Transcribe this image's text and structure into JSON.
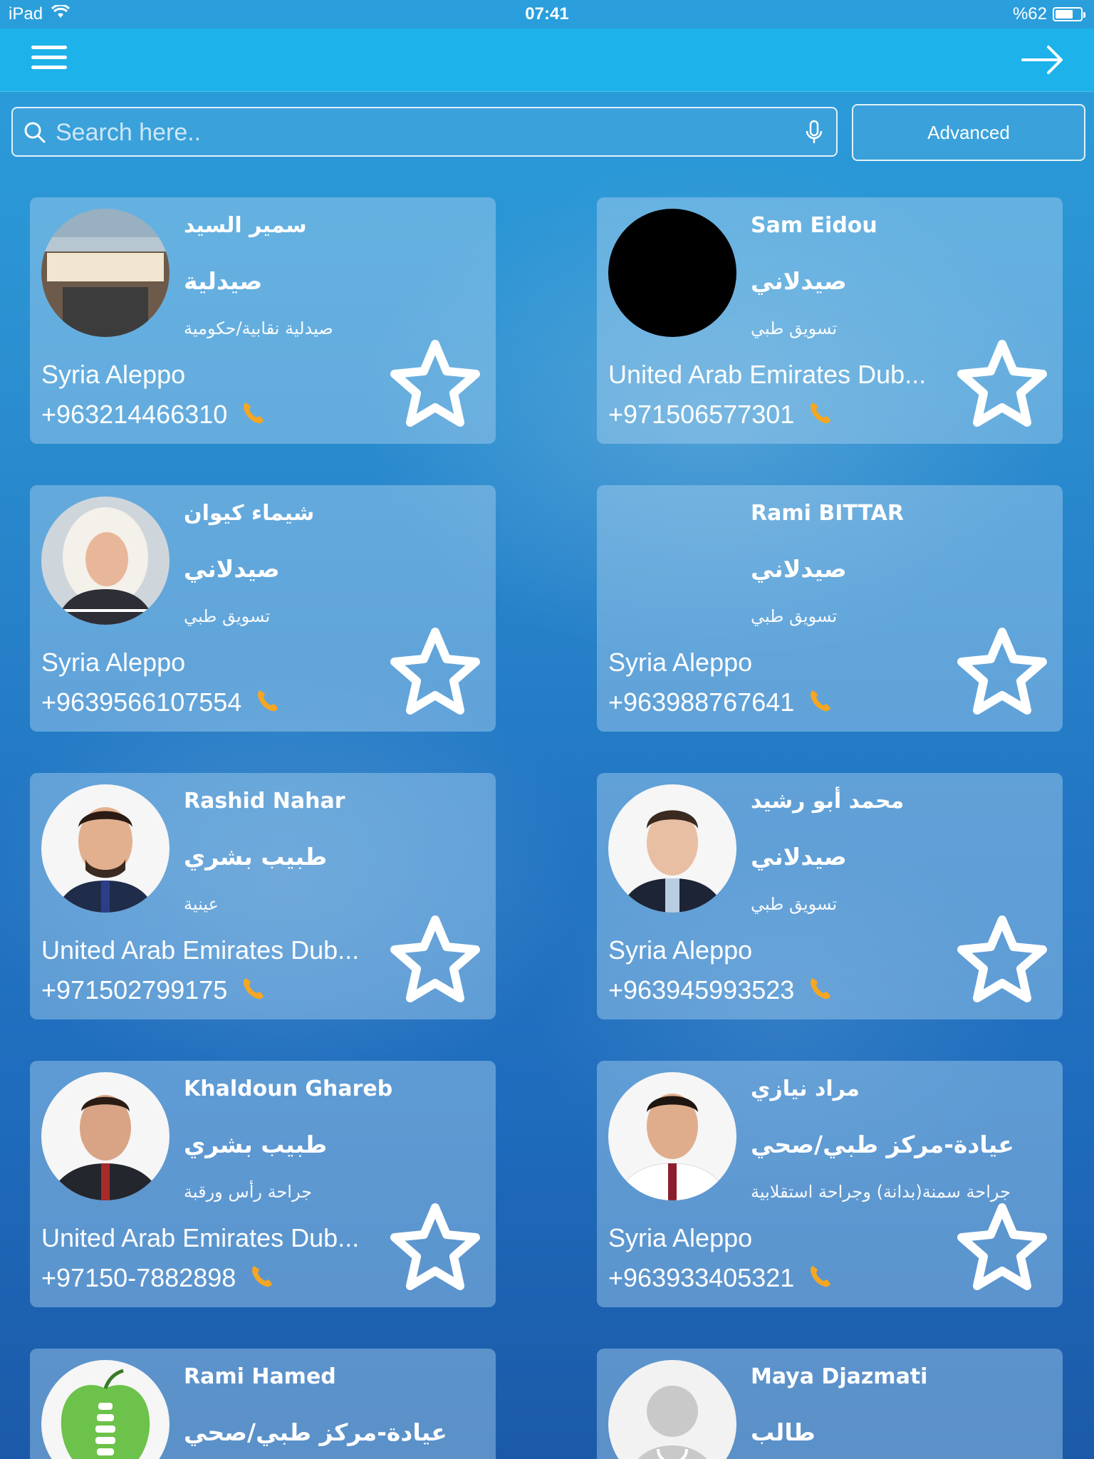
{
  "status_bar": {
    "device": "iPad",
    "time": "07:41",
    "battery": "%62"
  },
  "search": {
    "placeholder": "Search here..",
    "advanced_label": "Advanced"
  },
  "cards": [
    {
      "name": "سمير السيد",
      "specialty": "صيدلية",
      "subtitle": "صيدلية نقابية/حكومية",
      "location": "Syria Aleppo",
      "phone": "+963214466310",
      "avatar": "pharmacy-storefront-photo"
    },
    {
      "name": "Sam Eidou",
      "specialty": "صيدلاني",
      "subtitle": "تسويق طبي",
      "location": "United Arab Emirates Dub...",
      "phone": "+971506577301",
      "avatar": "black-circle"
    },
    {
      "name": "شيماء كيوان",
      "specialty": "صيدلاني",
      "subtitle": "تسويق طبي",
      "location": "Syria Aleppo",
      "phone": "+9639566107554",
      "avatar": "woman-hijab-photo"
    },
    {
      "name": "Rami BITTAR",
      "specialty": "صيدلاني",
      "subtitle": "تسويق طبي",
      "location": "Syria Aleppo",
      "phone": "+963988767641",
      "avatar": "none"
    },
    {
      "name": "Rashid Nahar",
      "specialty": "طبيب بشري",
      "subtitle": "عينية",
      "location": "United Arab Emirates Dub...",
      "phone": "+971502799175",
      "avatar": "man-glasses-photo"
    },
    {
      "name": "محمد أبو رشيد",
      "specialty": "صيدلاني",
      "subtitle": "تسويق طبي",
      "location": "Syria Aleppo",
      "phone": "+963945993523",
      "avatar": "young-man-photo"
    },
    {
      "name": "Khaldoun Ghareb",
      "specialty": "طبيب بشري",
      "subtitle": "جراحة رأس ورقبة",
      "location": "United Arab Emirates Dub...",
      "phone": "+97150-7882898",
      "avatar": "man-suit-photo"
    },
    {
      "name": "مراد نيازي",
      "specialty": "عيادة-مركز طبي/صحي",
      "subtitle": "جراحة سمنة(بدانة) وجراحة استقلابية",
      "location": "Syria Aleppo",
      "phone": "+963933405321",
      "avatar": "doctor-white-coat-photo"
    },
    {
      "name": "Rami Hamed",
      "specialty": "عيادة-مركز طبي/صحي",
      "subtitle": "",
      "location": "",
      "phone": "",
      "avatar": "green-apple-spine-logo"
    },
    {
      "name": "Maya Djazmati",
      "specialty": "طالب",
      "subtitle": "",
      "location": "",
      "phone": "",
      "avatar": "default-doctor-silhouette"
    }
  ],
  "colors": {
    "navbar": "#1eb2ea",
    "phone_icon": "#f5a623",
    "background": "#2377c4"
  }
}
